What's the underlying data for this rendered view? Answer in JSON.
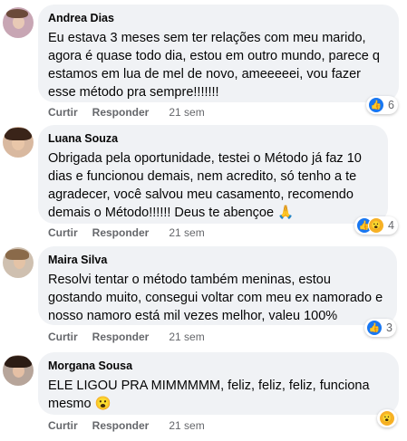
{
  "actions": {
    "like": "Curtir",
    "reply": "Responder"
  },
  "comments": [
    {
      "author": "Andrea Dias",
      "text": "Eu estava 3 meses sem ter relações com meu marido, agora é quase todo dia, estou em outro mundo, parece q estamos em lua de mel de novo, ameeeeei, vou fazer esse método pra sempre!!!!!!!",
      "time": "21 sem",
      "reaction_count": "6"
    },
    {
      "author": "Luana Souza",
      "text": "Obrigada pela oportunidade, testei o Método já faz 10 dias e funcionou demais, nem acredito, só tenho a te agradecer, você salvou meu casamento, recomendo demais o Método!!!!!! Deus te abençoe",
      "emoji": "🙏",
      "time": "21 sem",
      "reaction_count": "4"
    },
    {
      "author": "Maira Silva",
      "text": "Resolvi tentar o método também meninas, estou gostando muito, consegui voltar com meu ex namorado e nosso namoro está mil vezes melhor, valeu 100%",
      "time": "21 sem",
      "reaction_count": "3"
    },
    {
      "author": "Morgana Sousa",
      "text": "ELE LIGOU PRA MIMMMMM, feliz, feliz, feliz, funciona mesmo",
      "emoji": "😮",
      "time": "21 sem",
      "reaction_count": ""
    }
  ],
  "icons": {
    "like": "thumbs-up-icon",
    "wow": "wow-face-icon",
    "pray": "praying-hands-emoji"
  },
  "colors": {
    "bubble": "#f0f2f5",
    "meta_text": "#65676b",
    "like_blue": "#1877f2",
    "wow_yellow": "#f7b125"
  }
}
